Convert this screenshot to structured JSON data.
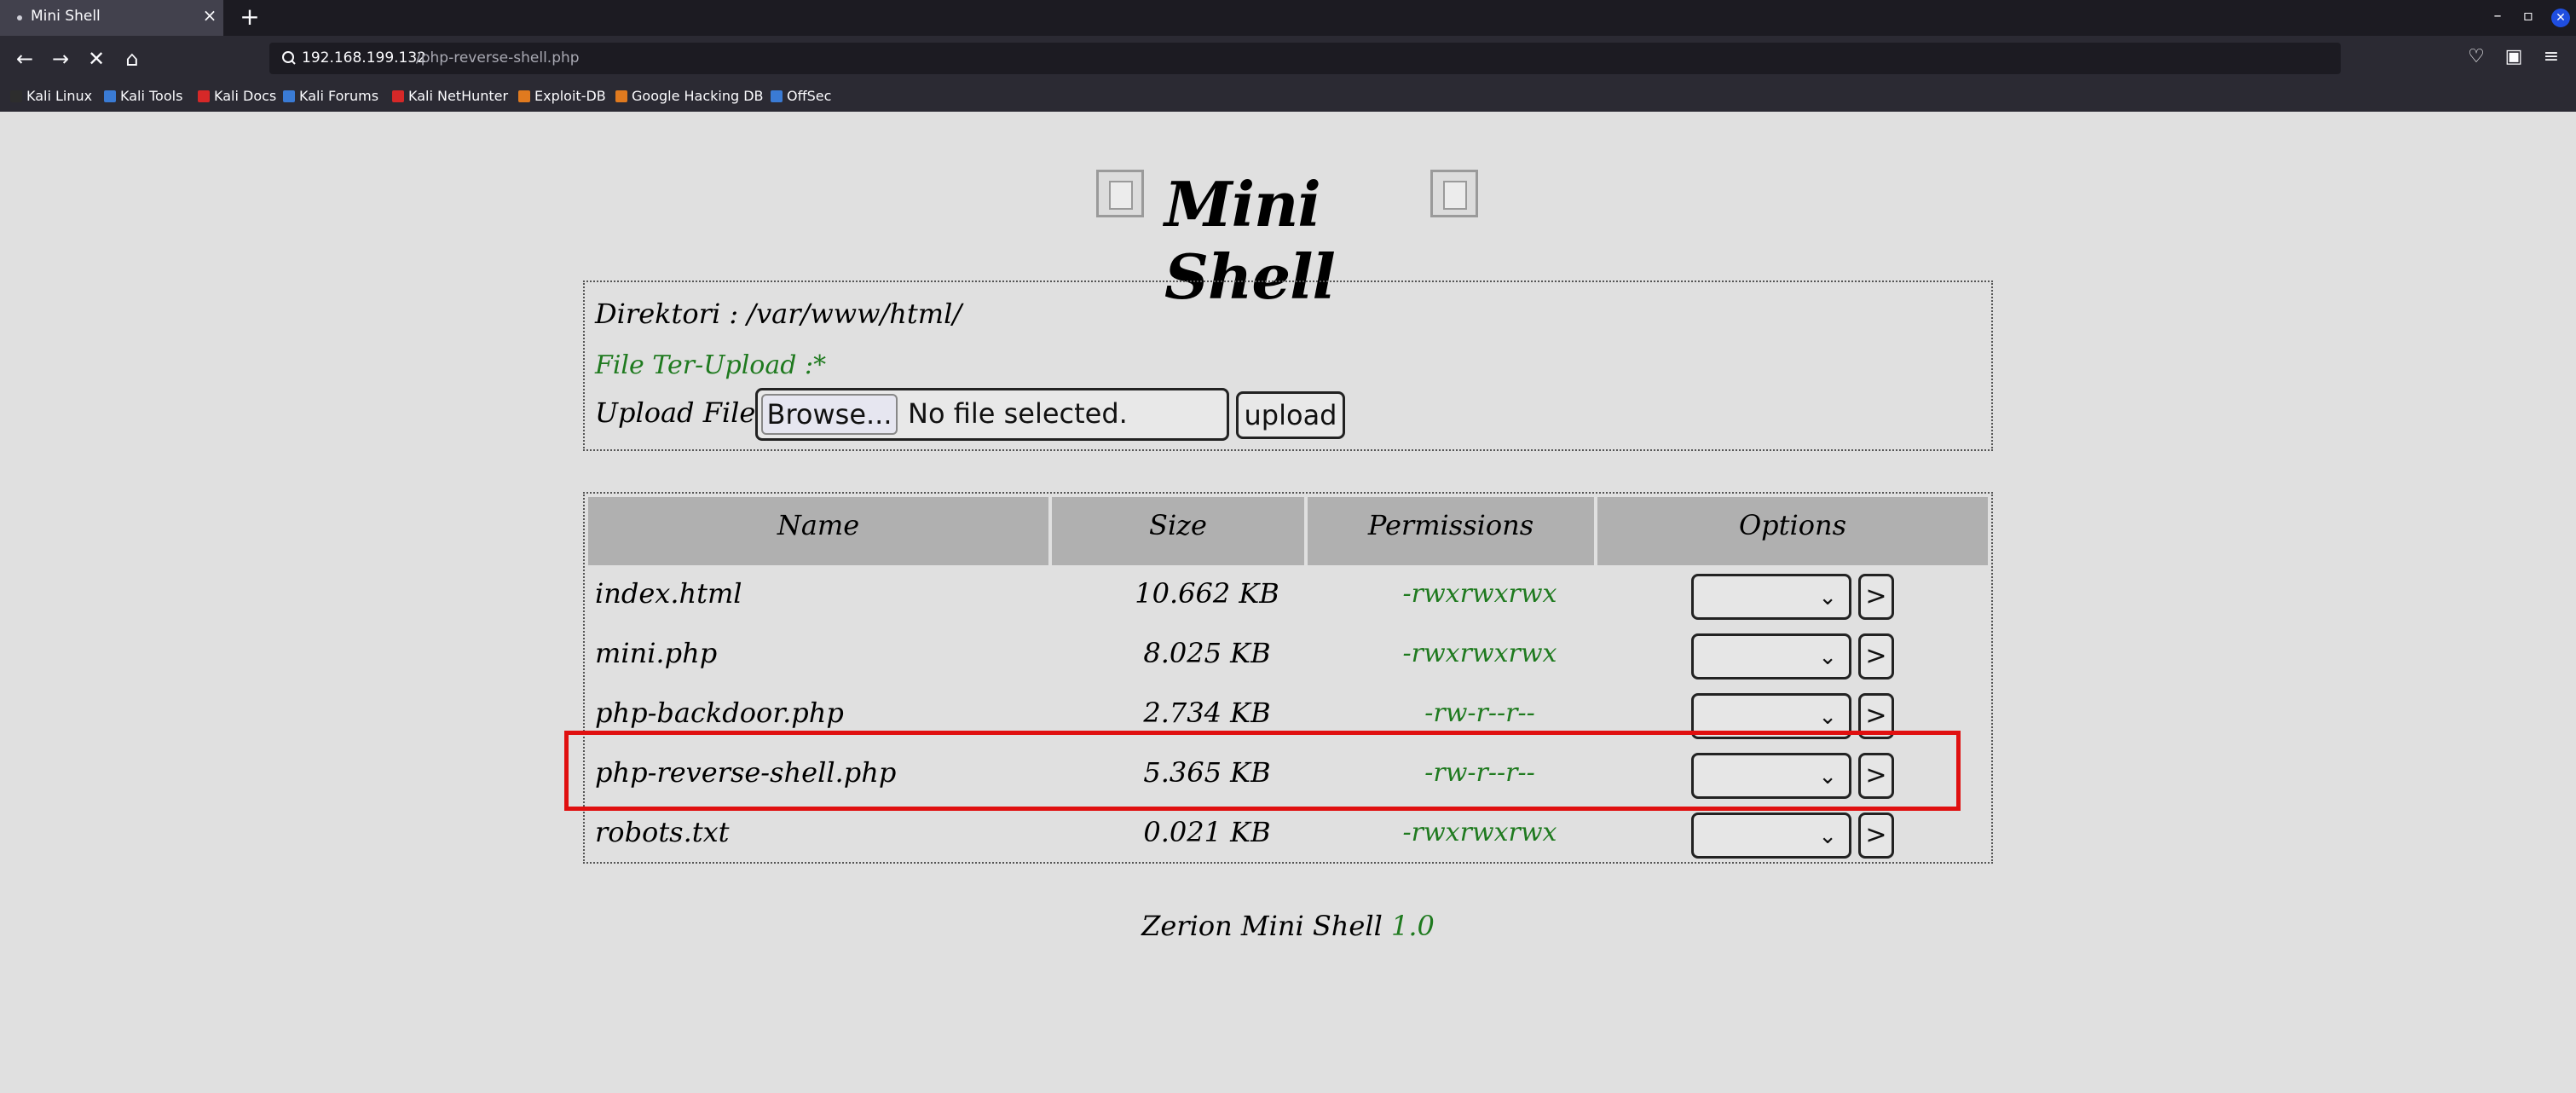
{
  "browser": {
    "tab_title": "Mini Shell",
    "tab_close": "×",
    "new_tab": "+",
    "url_host": "192.168.199.132",
    "url_path": "/php-reverse-shell.php",
    "bookmarks": [
      {
        "label": "Kali Linux",
        "color": "#2d2d2d"
      },
      {
        "label": "Kali Tools",
        "color": "#3a7bd5"
      },
      {
        "label": "Kali Docs",
        "color": "#d62828"
      },
      {
        "label": "Kali Forums",
        "color": "#3a7bd5"
      },
      {
        "label": "Kali NetHunter",
        "color": "#d62828"
      },
      {
        "label": "Exploit-DB",
        "color": "#e07a1f"
      },
      {
        "label": "Google Hacking DB",
        "color": "#e07a1f"
      },
      {
        "label": "OffSec",
        "color": "#3a7bd5"
      }
    ]
  },
  "page": {
    "title": "Mini Shell",
    "directory_label": "Direktori : /var/www/html/",
    "upload_status": "File Ter-Upload :*",
    "upload_label": "Upload File :",
    "browse_label": "Browse...",
    "no_file_text": "No file selected.",
    "upload_button": "upload",
    "table": {
      "headers": [
        "Name",
        "Size",
        "Permissions",
        "Options"
      ],
      "rows": [
        {
          "name": "index.html",
          "size": "10.662 KB",
          "perms": "-rwxrwxrwx"
        },
        {
          "name": "mini.php",
          "size": "8.025 KB",
          "perms": "-rwxrwxrwx"
        },
        {
          "name": "php-backdoor.php",
          "size": "2.734 KB",
          "perms": "-rw-r--r--"
        },
        {
          "name": "php-reverse-shell.php",
          "size": "5.365 KB",
          "perms": "-rw-r--r--"
        },
        {
          "name": "robots.txt",
          "size": "0.021 KB",
          "perms": "-rwxrwxrwx"
        }
      ],
      "go_label": ">"
    },
    "footer_text": "Zerion Mini Shell",
    "footer_version": "1.0",
    "highlight_color": "#e01010",
    "accent_green": "#1f7a1f"
  }
}
